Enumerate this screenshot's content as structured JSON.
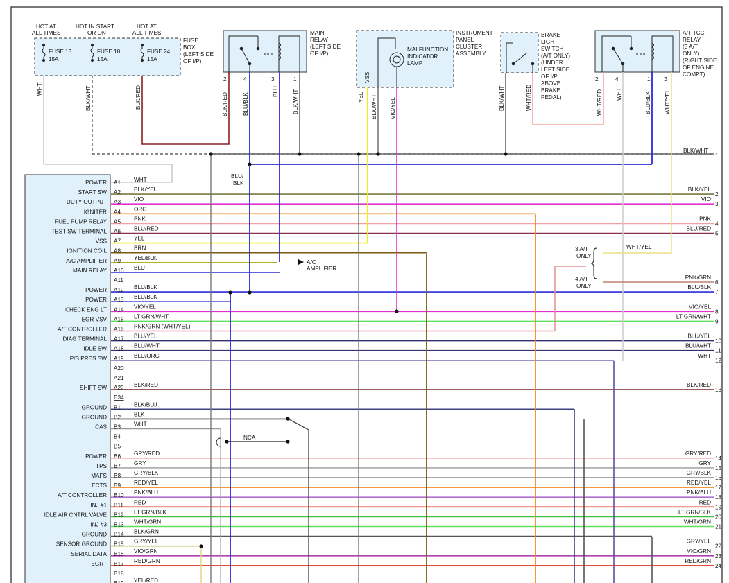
{
  "top": {
    "hot_all_1": [
      "HOT AT",
      "ALL TIMES"
    ],
    "hot_start": [
      "HOT IN START",
      "OR ON"
    ],
    "hot_all_2": [
      "HOT AT",
      "ALL TIMES"
    ],
    "fuses": [
      {
        "name": "FUSE 13",
        "amp": "15A"
      },
      {
        "name": "FUSE 18",
        "amp": "15A"
      },
      {
        "name": "FUSE 24",
        "amp": "15A"
      }
    ],
    "fuse_box": [
      "FUSE",
      "BOX",
      "(LEFT SIDE",
      "OF I/P)"
    ],
    "main_relay": [
      "MAIN",
      "RELAY",
      "(LEFT SIDE",
      "OF I/P)"
    ],
    "main_relay_pins": [
      "2",
      "4",
      "3",
      "1"
    ],
    "cluster": [
      "INSTRUMENT",
      "PANEL",
      "CLUSTER",
      "ASSEMBLY"
    ],
    "mil": [
      "MALFUNCTION",
      "INDICATOR",
      "LAMP"
    ],
    "brake_switch": [
      "BRAKE",
      "LIGHT",
      "SWITCH",
      "(A/T ONLY)",
      "(UNDER",
      "LEFT SIDE",
      "OF I/P",
      "ABOVE",
      "BRAKE",
      "PEDAL)"
    ],
    "tcc_relay": [
      "A/T TCC",
      "RELAY",
      "(3 A/T",
      "ONLY)",
      "(RIGHT SIDE",
      "OF ENGINE",
      "COMPT)"
    ],
    "tcc_relay_pins": [
      "2",
      "4",
      "1",
      "3"
    ],
    "wire_labels": [
      "WHT",
      "BLK/WHT",
      "BLK/RED",
      "BLK/RED",
      "BLU/BLK",
      "BLU",
      "BLK/WHT",
      "YEL",
      "VSS",
      "BLK/WHT",
      "VIO/YEL",
      "BLK/WHT",
      "WHT/RED",
      "WHT/RED",
      "WHT",
      "BLU/BLK",
      "WHT/YEL"
    ]
  },
  "bus_label": "BLK/WHT",
  "bus_number": "1",
  "blu_blk_label": [
    "BLU/",
    "BLK"
  ],
  "ac_amp": [
    "A/C",
    "AMPLIFIER"
  ],
  "at_notes": {
    "three": [
      "3 A/T",
      "ONLY"
    ],
    "four": [
      "4 A/T",
      "ONLY"
    ],
    "wht_yel": "WHT/YEL"
  },
  "nca": "NCA",
  "connector_e34": "E34",
  "colors": {
    "module_fill": "#e1f1fb",
    "wire_blue": "#2b2bd6",
    "wire_yellow": "#f0f000",
    "wire_magenta": "#e030d0",
    "wire_orange": "#f08a20",
    "wire_green": "#60e060",
    "wire_red": "#e03020",
    "wire_brown": "#7a5a10",
    "wire_pink": "#f0a0a0"
  },
  "ecm_pins": [
    {
      "func": "POWER",
      "pin": "A1",
      "wire": "WHT",
      "right": "",
      "num": ""
    },
    {
      "func": "START SW",
      "pin": "A2",
      "wire": "BLK/YEL",
      "right": "BLK/YEL",
      "num": "2"
    },
    {
      "func": "DUTY OUTPUT",
      "pin": "A3",
      "wire": "VIO",
      "right": "VIO",
      "num": "3"
    },
    {
      "func": "IGNITER",
      "pin": "A4",
      "wire": "ORG",
      "right": "",
      "num": ""
    },
    {
      "func": "FUEL PUMP RELAY",
      "pin": "A5",
      "wire": "PNK",
      "right": "PNK",
      "num": "4"
    },
    {
      "func": "TEST SW TERMINAL",
      "pin": "A6",
      "wire": "BLU/RED",
      "right": "BLU/RED",
      "num": "5"
    },
    {
      "func": "VSS",
      "pin": "A7",
      "wire": "YEL",
      "right": "",
      "num": ""
    },
    {
      "func": "IGNITION COIL",
      "pin": "A8",
      "wire": "BRN",
      "right": "",
      "num": ""
    },
    {
      "func": "A/C AMPLIFIER",
      "pin": "A9",
      "wire": "YEL/BLK",
      "right": "",
      "num": ""
    },
    {
      "func": "MAIN RELAY",
      "pin": "A10",
      "wire": "BLU",
      "right": "",
      "num": ""
    },
    {
      "func": "",
      "pin": "A11",
      "wire": "",
      "right": "PNK/GRN",
      "num": "6"
    },
    {
      "func": "POWER",
      "pin": "A12",
      "wire": "BLU/BLK",
      "right": "BLU/BLK",
      "num": "7"
    },
    {
      "func": "POWER",
      "pin": "A13",
      "wire": "BLU/BLK",
      "right": "",
      "num": ""
    },
    {
      "func": "CHECK ENG LT",
      "pin": "A14",
      "wire": "VIO/YEL",
      "right": "VIO/YEL",
      "num": "8"
    },
    {
      "func": "EGR VSV",
      "pin": "A15",
      "wire": "LT GRN/WHT",
      "right": "LT GRN/WHT",
      "num": "9"
    },
    {
      "func": "A/T CONTROLLER",
      "pin": "A16",
      "wire": "PNK/GRN (WHT/YEL)",
      "right": "",
      "num": ""
    },
    {
      "func": "DIAG TERMINAL",
      "pin": "A17",
      "wire": "BLU/YEL",
      "right": "BLU/YEL",
      "num": "10"
    },
    {
      "func": "IDLE SW",
      "pin": "A18",
      "wire": "BLU/WHT",
      "right": "BLU/WHT",
      "num": "11"
    },
    {
      "func": "P/S PRES SW",
      "pin": "A19",
      "wire": "BLU/ORG",
      "right": "WHT",
      "num": "12"
    },
    {
      "func": "",
      "pin": "A20",
      "wire": "",
      "right": "",
      "num": ""
    },
    {
      "func": "",
      "pin": "A21",
      "wire": "",
      "right": "",
      "num": ""
    },
    {
      "func": "SHIFT SW",
      "pin": "A22",
      "wire": "BLK/RED",
      "right": "BLK/RED",
      "num": "13"
    },
    {
      "func": "",
      "pin": "E34",
      "wire": "",
      "right": "",
      "num": ""
    },
    {
      "func": "GROUND",
      "pin": "B1",
      "wire": "BLK/BLU",
      "right": "",
      "num": ""
    },
    {
      "func": "GROUND",
      "pin": "B2",
      "wire": "BLK",
      "right": "",
      "num": ""
    },
    {
      "func": "CAS",
      "pin": "B3",
      "wire": "WHT",
      "right": "",
      "num": ""
    },
    {
      "func": "",
      "pin": "B4",
      "wire": "",
      "right": "",
      "num": ""
    },
    {
      "func": "",
      "pin": "B5",
      "wire": "",
      "right": "",
      "num": ""
    },
    {
      "func": "POWER",
      "pin": "B6",
      "wire": "GRY/RED",
      "right": "GRY/RED",
      "num": "14"
    },
    {
      "func": "TPS",
      "pin": "B7",
      "wire": "GRY",
      "right": "GRY",
      "num": "15"
    },
    {
      "func": "MAFS",
      "pin": "B8",
      "wire": "GRY/BLK",
      "right": "GRY/BLK",
      "num": "16"
    },
    {
      "func": "ECTS",
      "pin": "B9",
      "wire": "RED/YEL",
      "right": "RED/YEL",
      "num": "17"
    },
    {
      "func": "A/T CONTROLLER",
      "pin": "B10",
      "wire": "PNK/BLU",
      "right": "PNK/BLU",
      "num": "18"
    },
    {
      "func": "INJ #1",
      "pin": "B11",
      "wire": "RED",
      "right": "RED",
      "num": "19"
    },
    {
      "func": "IDLE AIR CNTRL VALVE",
      "pin": "B12",
      "wire": "LT GRN/BLK",
      "right": "LT GRN/BLK",
      "num": "20"
    },
    {
      "func": "INJ #3",
      "pin": "B13",
      "wire": "WHT/GRN",
      "right": "WHT/GRN",
      "num": "21"
    },
    {
      "func": "GROUND",
      "pin": "B14",
      "wire": "BLK/GRN",
      "right": "",
      "num": ""
    },
    {
      "func": "SENSOR GROUND",
      "pin": "B15",
      "wire": "GRY/YEL",
      "right": "GRY/YEL",
      "num": "22"
    },
    {
      "func": "SERIAL DATA",
      "pin": "B16",
      "wire": "VIO/GRN",
      "right": "VIO/GRN",
      "num": "23"
    },
    {
      "func": "EGRT",
      "pin": "B17",
      "wire": "RED/GRN",
      "right": "RED/GRN",
      "num": "24"
    },
    {
      "func": "",
      "pin": "B18",
      "wire": "",
      "right": "",
      "num": ""
    },
    {
      "func": "",
      "pin": "B19",
      "wire": "YEL/RED",
      "right": "",
      "num": ""
    }
  ]
}
